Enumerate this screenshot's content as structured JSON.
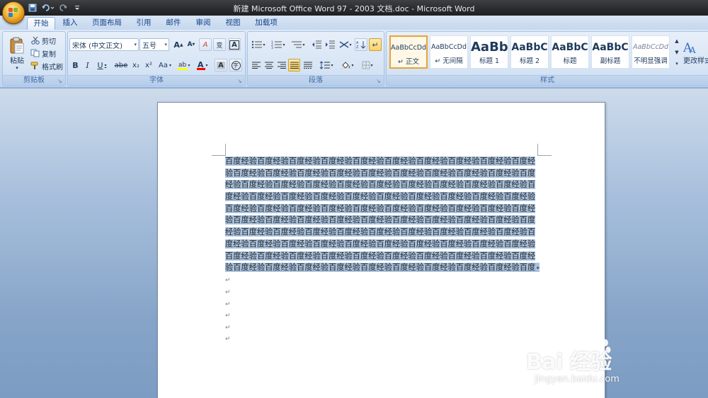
{
  "window": {
    "title": "新建 Microsoft Office Word 97 - 2003 文档.doc - Microsoft Word"
  },
  "quick_access": {
    "icons": [
      "save-icon",
      "undo-icon",
      "redo-icon",
      "customize-icon"
    ]
  },
  "tabs": [
    {
      "label": "开始",
      "active": true
    },
    {
      "label": "插入"
    },
    {
      "label": "页面布局"
    },
    {
      "label": "引用"
    },
    {
      "label": "邮件"
    },
    {
      "label": "审阅"
    },
    {
      "label": "视图"
    },
    {
      "label": "加载项"
    }
  ],
  "clipboard": {
    "group_label": "剪贴板",
    "paste": "粘贴",
    "cut": "剪切",
    "copy": "复制",
    "format_painter": "格式刷"
  },
  "font": {
    "group_label": "字体",
    "font_name": "宋体 (中文正文)",
    "font_size": "五号",
    "bold": "B",
    "italic": "I",
    "underline": "U",
    "strikethrough": "abe",
    "subscript": "x₂",
    "superscript": "x²",
    "change_case": "Aa",
    "grow": "A",
    "shrink": "A",
    "clear_format": "A",
    "phonetic": "A",
    "border_char": "A",
    "enclose": "字",
    "highlight_color": "#ffff00",
    "font_color": "#ff0000"
  },
  "paragraph": {
    "group_label": "段落"
  },
  "styles": {
    "group_label": "样式",
    "items": [
      {
        "sample": "AaBbCcDd",
        "name": "↵ 正文",
        "selected": true
      },
      {
        "sample": "AaBbCcDd",
        "name": "↵ 无间隔"
      },
      {
        "sample": "AaBb",
        "name": "标题 1"
      },
      {
        "sample": "AaBbC",
        "name": "标题 2"
      },
      {
        "sample": "AaBbC",
        "name": "标题"
      },
      {
        "sample": "AaBbC",
        "name": "副标题"
      },
      {
        "sample": "AaBbCcDd",
        "name": "不明显强调"
      }
    ],
    "change_styles": "更改样式"
  },
  "document": {
    "lines": [
      "百度经验百度经验百度经验百度经验百度经验百度经验百度经验百度经验百度经验百度经",
      "验百度经验百度经验百度经验百度经验百度经验百度经验百度经验百度经验百度经验百度",
      "经验百度经验百度经验百度经验百度经验百度经验百度经验百度经验百度经验百度经验百",
      "度经验百度经验百度经验百度经验百度经验百度经验百度经验百度经验百度经验百度经验",
      "百度经验百度经验百度经验百度经验百度经验百度经验百度经验百度经验百度经验百度经",
      "验百度经验百度经验百度经验百度经验百度经验百度经验百度经验百度经验百度经验百度",
      "经验百度经验百度经验百度经验百度经验百度经验百度经验百度经验百度经验百度经验百",
      "度经验百度经验百度经验百度经验百度经验百度经验百度经验百度经验百度经验百度经验",
      "百度经验百度经验百度经验百度经验百度经验百度经验百度经验百度经验百度经验百度经",
      "验百度经验百度经验百度经验百度经验百度经验百度经验百度经验百度经验百度经验百度↵"
    ],
    "empty_paragraph_mark": "↵",
    "empty_paragraphs": 6,
    "selection_color": "#a9c3e0"
  },
  "watermark": {
    "brand": "Bai 经验",
    "url": "jingyan.baidu.com"
  }
}
